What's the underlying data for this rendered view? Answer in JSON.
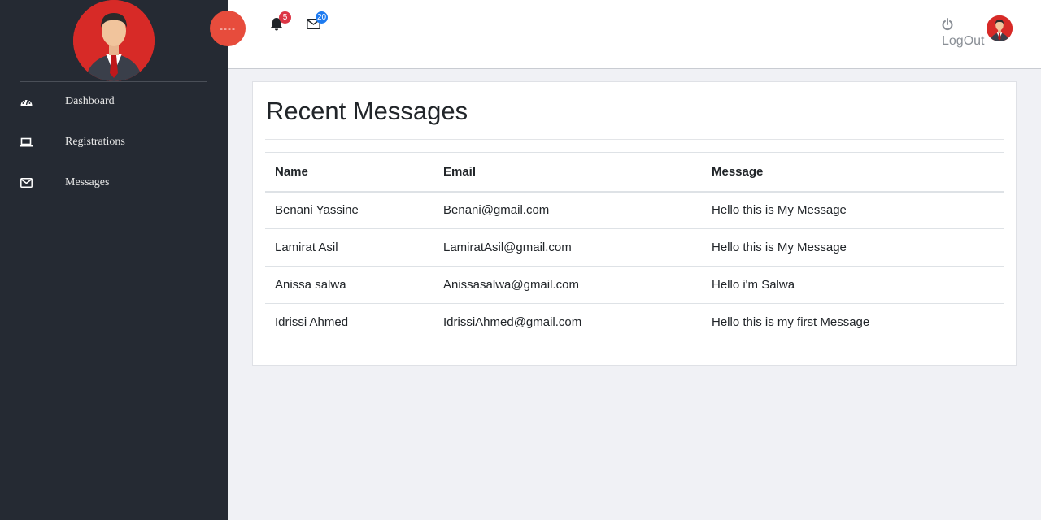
{
  "sidebar": {
    "items": [
      {
        "label": "Dashboard",
        "icon": "dashboard-icon"
      },
      {
        "label": "Registrations",
        "icon": "laptop-icon"
      },
      {
        "label": "Messages",
        "icon": "envelope-icon"
      }
    ]
  },
  "header": {
    "toggle_label": "----",
    "notifications_count": "5",
    "messages_count": "20",
    "logout_label": "LogOut"
  },
  "main": {
    "title": "Recent Messages",
    "table": {
      "headers": [
        "Name",
        "Email",
        "Message"
      ],
      "rows": [
        [
          "Benani Yassine",
          "Benani@gmail.com",
          "Hello this is My Message"
        ],
        [
          "Lamirat Asil",
          "LamiratAsil@gmail.com",
          "Hello this is My Message"
        ],
        [
          "Anissa salwa",
          "Anissasalwa@gmail.com",
          "Hello i'm Salwa"
        ],
        [
          "Idrissi Ahmed",
          "IdrissiAhmed@gmail.com",
          "Hello this is my first Message"
        ]
      ]
    }
  },
  "colors": {
    "sidebar_bg": "#252a33",
    "accent_red": "#e74c3c",
    "badge_red": "#dc3545",
    "badge_blue": "#1e7bf0"
  }
}
